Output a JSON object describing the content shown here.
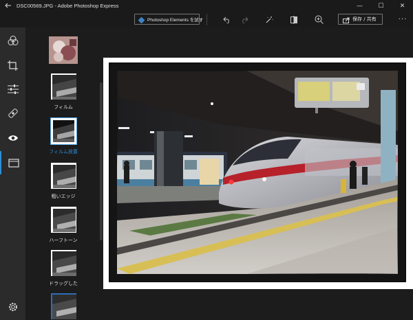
{
  "window": {
    "title": "DSC00569.JPG - Adobe Photoshop Express",
    "back_icon": "back-arrow-icon",
    "minimize_glyph": "—",
    "maximize_glyph": "☐",
    "close_glyph": "✕"
  },
  "toolbar": {
    "pse_label": "Photoshop Elements を試す",
    "save_label": "保存 / 共有",
    "more_label": "···",
    "icons": [
      "undo-icon",
      "redo-icon",
      "auto-fix-icon",
      "compare-icon",
      "zoom-icon"
    ]
  },
  "rail": {
    "items": [
      "looks-icon",
      "crop-icon",
      "adjustments-icon",
      "healing-icon",
      "eye-icon",
      "borders-icon"
    ],
    "active": "borders-icon",
    "settings": "settings-icon"
  },
  "effects": {
    "items": [
      {
        "label": "",
        "selected": false
      },
      {
        "label": "フィルム",
        "selected": false
      },
      {
        "label": "フィルム放置",
        "selected": true
      },
      {
        "label": "粗いエッジ",
        "selected": false
      },
      {
        "label": "ハーフトーン",
        "selected": false
      },
      {
        "label": "ドラッグした",
        "selected": false
      },
      {
        "label": "",
        "selected": false
      }
    ]
  },
  "colors": {
    "accent": "#2b8fd6",
    "background": "#1c1c1c",
    "rail": "#2b2b2b"
  }
}
